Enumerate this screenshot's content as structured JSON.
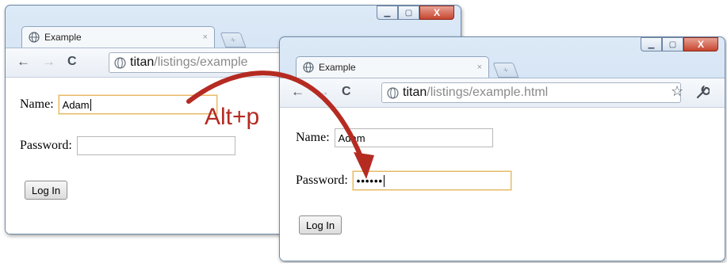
{
  "windows": [
    {
      "tab": {
        "title": "Example",
        "close": "×"
      },
      "url": {
        "host": "titan",
        "path": "/listings/example"
      },
      "fields": {
        "name": {
          "label": "Name:",
          "value": "Adam"
        },
        "password": {
          "label": "Password:",
          "value": ""
        }
      },
      "login_button": "Log In"
    },
    {
      "tab": {
        "title": "Example",
        "close": "×"
      },
      "url": {
        "host": "titan",
        "path": "/listings/example.html"
      },
      "fields": {
        "name": {
          "label": "Name:",
          "value": "Adam"
        },
        "password": {
          "label": "Password:",
          "value": "••••••"
        }
      },
      "login_button": "Log In"
    }
  ],
  "annotation": {
    "shortcut": "Alt+p",
    "color": "#b52b22"
  },
  "icons": {
    "back": "←",
    "forward": "→",
    "reload": "C",
    "star": "☆",
    "wrench": "🔧",
    "minimize": "▁",
    "maximize": "▢",
    "close": "X",
    "new_tab": "+"
  }
}
